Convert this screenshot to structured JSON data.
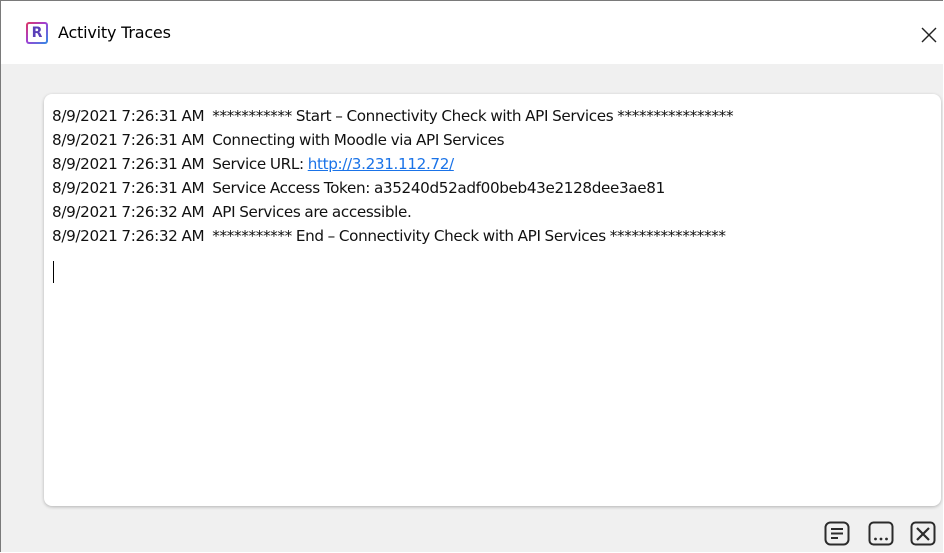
{
  "window": {
    "title": "Activity Traces",
    "app_icon_letter": "R",
    "close_icon": "close-icon"
  },
  "log": {
    "lines": [
      {
        "timestamp": "8/9/2021 7:26:31 AM",
        "text": "*********** Start – Connectivity Check with API Services ****************"
      },
      {
        "timestamp": "8/9/2021 7:26:31 AM",
        "text": "Connecting with Moodle via API Services"
      },
      {
        "timestamp": "8/9/2021 7:26:31 AM",
        "text_prefix": "Service URL: ",
        "link": "http://3.231.112.72/"
      },
      {
        "timestamp": "8/9/2021 7:26:31 AM",
        "text": "Service Access Token: a35240d52adf00beb43e2128dee3ae81"
      },
      {
        "timestamp": "8/9/2021 7:26:32 AM",
        "text": "API Services are accessible."
      },
      {
        "timestamp": "8/9/2021 7:26:32 AM",
        "text": "*********** End – Connectivity Check with API Services ****************"
      }
    ]
  },
  "toolbar": {
    "buttons": [
      {
        "icon": "text-lines-icon"
      },
      {
        "icon": "more-options-icon"
      },
      {
        "icon": "clear-icon"
      }
    ]
  },
  "colors": {
    "link": "#1a73e8",
    "panel_background": "#f0f0f0",
    "log_background": "#ffffff"
  }
}
